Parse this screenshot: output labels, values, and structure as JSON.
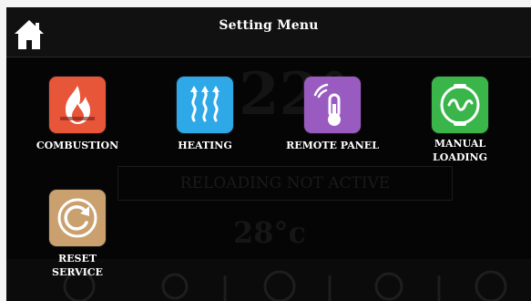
{
  "header": {
    "title": "Setting Menu",
    "home_icon": "home-icon"
  },
  "background": {
    "temperature_large": "22°",
    "status_text": "RELOADING NOT ACTIVE",
    "temperature_small": "28°c"
  },
  "menu": {
    "items": [
      {
        "label": "COMBUSTION",
        "icon": "fire-icon",
        "color": "#e8563a"
      },
      {
        "label": "HEATING",
        "icon": "heat-waves-icon",
        "color": "#2fa8e8"
      },
      {
        "label": "REMOTE PANEL",
        "icon": "remote-thermometer-icon",
        "color": "#9a5bc0"
      },
      {
        "label": "MANUAL\nLOADING",
        "icon": "pellet-load-icon",
        "color": "#39b54a"
      },
      {
        "label": "RESET\nSERVICE",
        "icon": "reset-icon",
        "color": "#c9a06e"
      }
    ]
  }
}
